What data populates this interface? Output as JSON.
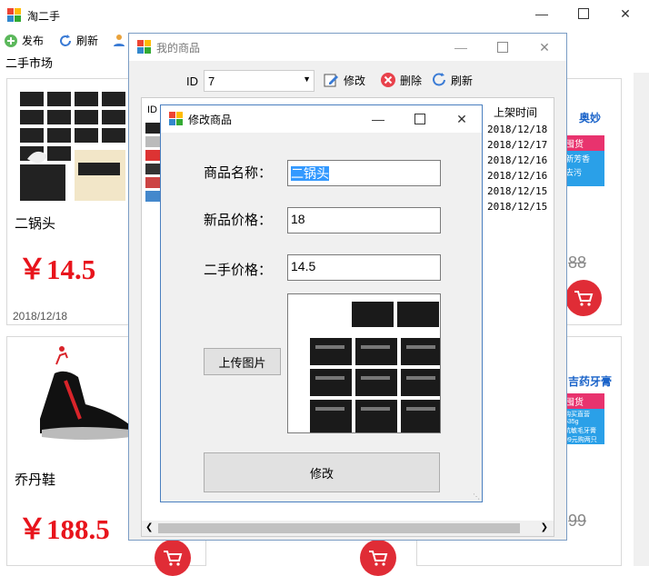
{
  "main": {
    "title": "淘二手",
    "toolbar": {
      "publish": "发布",
      "refresh": "刷新"
    },
    "section_label": "二手市场",
    "products": [
      {
        "name": "二锅头",
        "price": "￥14.5",
        "date": "2018/12/18"
      },
      {
        "name": "乔丹鞋",
        "price": "￥188.5"
      }
    ],
    "partial_prices": [
      "88",
      "99"
    ],
    "ad_texts": [
      "奥妙",
      "囤货",
      "新芳香",
      "去污",
      "吉药牙膏",
      "囤货",
      "购买直营535g",
      "抗敏毛牙膏",
      "99元购两只"
    ]
  },
  "mygoods": {
    "title": "我的商品",
    "id_label": "ID",
    "id_value": "7",
    "edit": "修改",
    "delete": "删除",
    "refresh": "刷新",
    "col_id": "ID",
    "col_date": "上架时间",
    "dates": [
      "2018/12/18",
      "2018/12/17",
      "2018/12/16",
      "2018/12/16",
      "2018/12/15",
      "2018/12/15"
    ]
  },
  "edit": {
    "title": "修改商品",
    "name_label": "商品名称：",
    "name_value": "二锅头",
    "new_label": "新品价格：",
    "new_value": "18",
    "used_label": "二手价格：",
    "used_value": "14.5",
    "upload": "上传图片",
    "submit": "修改"
  },
  "colors": {
    "accent_red": "#e8141c",
    "cart_red": "#e02c36",
    "selection": "#3399ff",
    "frame_border": "#7a9cc4"
  }
}
